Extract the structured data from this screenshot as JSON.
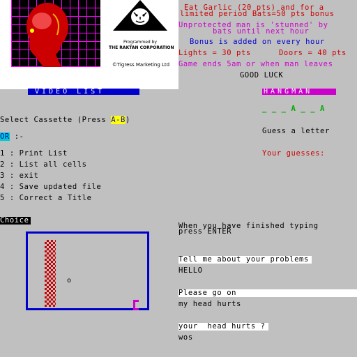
{
  "cover": {
    "programmed_by": "Programmed by",
    "company": "THE RAKTAN CORPORATION",
    "copyright": "©Tigress Marketing Ltd"
  },
  "game_info": {
    "line1": "Eat Garlic (20 pts) and for a",
    "line2": "limited period Bats=50 pts bonus",
    "stunned1": "Unprotected man is 'stunned' by",
    "stunned2": "bats until next hour",
    "bonus": "Bonus is added on every hour",
    "lights": "Lights = 30 pts",
    "doors": "Doors = 40 pts",
    "ends": "Game ends 5am or when man leaves",
    "good_luck": "GOOD LUCK"
  },
  "video_list": {
    "title": "VIDEO LIST",
    "select_prefix": "Select Cassette (Press ",
    "select_key": "A-B",
    "select_suffix": ")",
    "or_label": "OR",
    "or_suffix": " :-",
    "menu": [
      "1 : Print List",
      "2 : List all cells",
      "3 : exit",
      "4 : Save updated file",
      "5 : Correct a Title"
    ],
    "choice_label": "Choice"
  },
  "hangman": {
    "title": "HANGMAN",
    "word": "_ _ _ A _ _ A",
    "prompt": "Guess a letter",
    "guesses_label": "Your guesses:"
  },
  "therapist": {
    "finished1": "When you have finished typing",
    "finished2": "press ENTER",
    "q1": "Tell me about your problems",
    "a1": "HELLO",
    "q2": "Please go on",
    "a2": "my head hurts",
    "q3": "your  head hurts ?",
    "a3": "wos"
  },
  "game_scene": {
    "man_glyph": "o"
  },
  "colors": {
    "background": "#c0c0c0",
    "red": "#cc0000",
    "blue": "#0000cc",
    "magenta": "#cc00cc",
    "green": "#00cc00",
    "cyan": "#00cccc",
    "yellow": "#ffff00"
  }
}
